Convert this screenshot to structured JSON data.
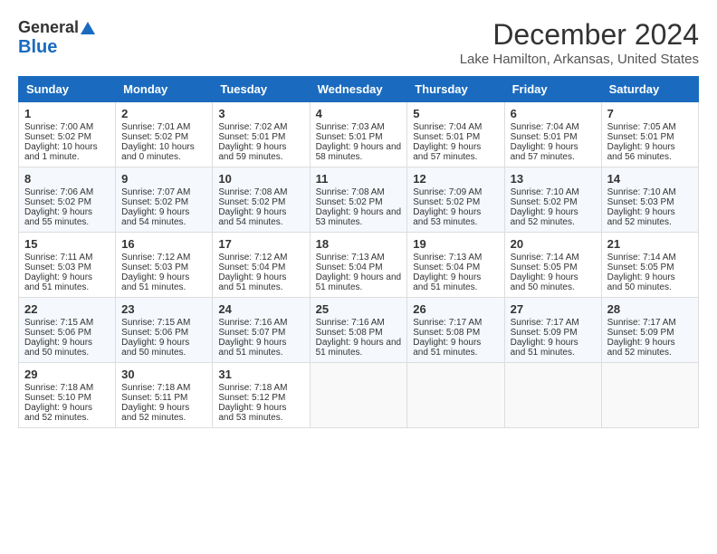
{
  "header": {
    "logo_general": "General",
    "logo_blue": "Blue",
    "main_title": "December 2024",
    "subtitle": "Lake Hamilton, Arkansas, United States"
  },
  "columns": [
    "Sunday",
    "Monday",
    "Tuesday",
    "Wednesday",
    "Thursday",
    "Friday",
    "Saturday"
  ],
  "weeks": [
    [
      {
        "day": "1",
        "sunrise": "Sunrise: 7:00 AM",
        "sunset": "Sunset: 5:02 PM",
        "daylight": "Daylight: 10 hours and 1 minute."
      },
      {
        "day": "2",
        "sunrise": "Sunrise: 7:01 AM",
        "sunset": "Sunset: 5:02 PM",
        "daylight": "Daylight: 10 hours and 0 minutes."
      },
      {
        "day": "3",
        "sunrise": "Sunrise: 7:02 AM",
        "sunset": "Sunset: 5:01 PM",
        "daylight": "Daylight: 9 hours and 59 minutes."
      },
      {
        "day": "4",
        "sunrise": "Sunrise: 7:03 AM",
        "sunset": "Sunset: 5:01 PM",
        "daylight": "Daylight: 9 hours and 58 minutes."
      },
      {
        "day": "5",
        "sunrise": "Sunrise: 7:04 AM",
        "sunset": "Sunset: 5:01 PM",
        "daylight": "Daylight: 9 hours and 57 minutes."
      },
      {
        "day": "6",
        "sunrise": "Sunrise: 7:04 AM",
        "sunset": "Sunset: 5:01 PM",
        "daylight": "Daylight: 9 hours and 57 minutes."
      },
      {
        "day": "7",
        "sunrise": "Sunrise: 7:05 AM",
        "sunset": "Sunset: 5:01 PM",
        "daylight": "Daylight: 9 hours and 56 minutes."
      }
    ],
    [
      {
        "day": "8",
        "sunrise": "Sunrise: 7:06 AM",
        "sunset": "Sunset: 5:02 PM",
        "daylight": "Daylight: 9 hours and 55 minutes."
      },
      {
        "day": "9",
        "sunrise": "Sunrise: 7:07 AM",
        "sunset": "Sunset: 5:02 PM",
        "daylight": "Daylight: 9 hours and 54 minutes."
      },
      {
        "day": "10",
        "sunrise": "Sunrise: 7:08 AM",
        "sunset": "Sunset: 5:02 PM",
        "daylight": "Daylight: 9 hours and 54 minutes."
      },
      {
        "day": "11",
        "sunrise": "Sunrise: 7:08 AM",
        "sunset": "Sunset: 5:02 PM",
        "daylight": "Daylight: 9 hours and 53 minutes."
      },
      {
        "day": "12",
        "sunrise": "Sunrise: 7:09 AM",
        "sunset": "Sunset: 5:02 PM",
        "daylight": "Daylight: 9 hours and 53 minutes."
      },
      {
        "day": "13",
        "sunrise": "Sunrise: 7:10 AM",
        "sunset": "Sunset: 5:02 PM",
        "daylight": "Daylight: 9 hours and 52 minutes."
      },
      {
        "day": "14",
        "sunrise": "Sunrise: 7:10 AM",
        "sunset": "Sunset: 5:03 PM",
        "daylight": "Daylight: 9 hours and 52 minutes."
      }
    ],
    [
      {
        "day": "15",
        "sunrise": "Sunrise: 7:11 AM",
        "sunset": "Sunset: 5:03 PM",
        "daylight": "Daylight: 9 hours and 51 minutes."
      },
      {
        "day": "16",
        "sunrise": "Sunrise: 7:12 AM",
        "sunset": "Sunset: 5:03 PM",
        "daylight": "Daylight: 9 hours and 51 minutes."
      },
      {
        "day": "17",
        "sunrise": "Sunrise: 7:12 AM",
        "sunset": "Sunset: 5:04 PM",
        "daylight": "Daylight: 9 hours and 51 minutes."
      },
      {
        "day": "18",
        "sunrise": "Sunrise: 7:13 AM",
        "sunset": "Sunset: 5:04 PM",
        "daylight": "Daylight: 9 hours and 51 minutes."
      },
      {
        "day": "19",
        "sunrise": "Sunrise: 7:13 AM",
        "sunset": "Sunset: 5:04 PM",
        "daylight": "Daylight: 9 hours and 51 minutes."
      },
      {
        "day": "20",
        "sunrise": "Sunrise: 7:14 AM",
        "sunset": "Sunset: 5:05 PM",
        "daylight": "Daylight: 9 hours and 50 minutes."
      },
      {
        "day": "21",
        "sunrise": "Sunrise: 7:14 AM",
        "sunset": "Sunset: 5:05 PM",
        "daylight": "Daylight: 9 hours and 50 minutes."
      }
    ],
    [
      {
        "day": "22",
        "sunrise": "Sunrise: 7:15 AM",
        "sunset": "Sunset: 5:06 PM",
        "daylight": "Daylight: 9 hours and 50 minutes."
      },
      {
        "day": "23",
        "sunrise": "Sunrise: 7:15 AM",
        "sunset": "Sunset: 5:06 PM",
        "daylight": "Daylight: 9 hours and 50 minutes."
      },
      {
        "day": "24",
        "sunrise": "Sunrise: 7:16 AM",
        "sunset": "Sunset: 5:07 PM",
        "daylight": "Daylight: 9 hours and 51 minutes."
      },
      {
        "day": "25",
        "sunrise": "Sunrise: 7:16 AM",
        "sunset": "Sunset: 5:08 PM",
        "daylight": "Daylight: 9 hours and 51 minutes."
      },
      {
        "day": "26",
        "sunrise": "Sunrise: 7:17 AM",
        "sunset": "Sunset: 5:08 PM",
        "daylight": "Daylight: 9 hours and 51 minutes."
      },
      {
        "day": "27",
        "sunrise": "Sunrise: 7:17 AM",
        "sunset": "Sunset: 5:09 PM",
        "daylight": "Daylight: 9 hours and 51 minutes."
      },
      {
        "day": "28",
        "sunrise": "Sunrise: 7:17 AM",
        "sunset": "Sunset: 5:09 PM",
        "daylight": "Daylight: 9 hours and 52 minutes."
      }
    ],
    [
      {
        "day": "29",
        "sunrise": "Sunrise: 7:18 AM",
        "sunset": "Sunset: 5:10 PM",
        "daylight": "Daylight: 9 hours and 52 minutes."
      },
      {
        "day": "30",
        "sunrise": "Sunrise: 7:18 AM",
        "sunset": "Sunset: 5:11 PM",
        "daylight": "Daylight: 9 hours and 52 minutes."
      },
      {
        "day": "31",
        "sunrise": "Sunrise: 7:18 AM",
        "sunset": "Sunset: 5:12 PM",
        "daylight": "Daylight: 9 hours and 53 minutes."
      },
      null,
      null,
      null,
      null
    ]
  ]
}
